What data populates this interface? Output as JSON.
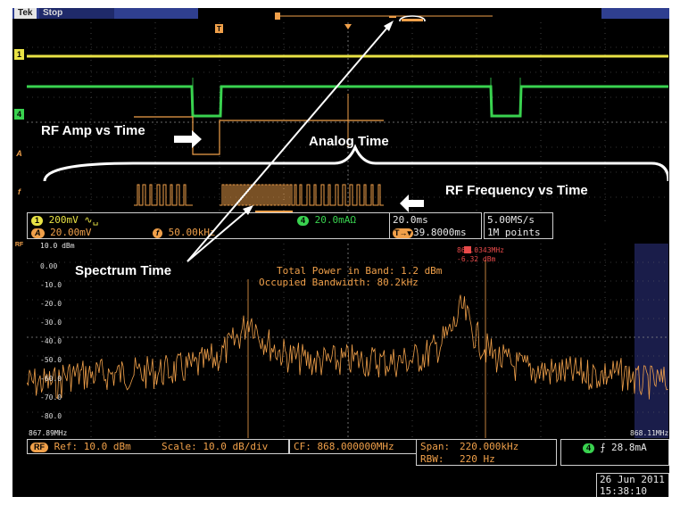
{
  "titlebar": {
    "brand": "Tek",
    "state": "Stop"
  },
  "channels": {
    "ch1": {
      "marker": "1",
      "scale": "200mV",
      "color": "#e8e245"
    },
    "ch4": {
      "marker": "4",
      "scale": "20.0mA",
      "unit_suffix": "Ω",
      "color": "#39d24f"
    },
    "math_a": {
      "marker": "A",
      "scale": "20.00mV",
      "color": "#f0a04a"
    },
    "math_f": {
      "marker": "f",
      "scale": "50.00kHz",
      "color": "#f0a04a"
    }
  },
  "timebase": {
    "scale": "20.0ms",
    "trigger_pos": "39.8000ms",
    "sample_rate": "5.00MS/s",
    "record": "1M points"
  },
  "annotations": {
    "rf_amp": "RF Amp vs Time",
    "analog_time": "Analog Time",
    "rf_freq": "RF Frequency vs Time",
    "spectrum_time": "Spectrum Time"
  },
  "rf": {
    "marker": "RF",
    "y_ticks": [
      "10.0 dBm",
      "0.00",
      "-10.0",
      "-20.0",
      "-30.0",
      "-40.0",
      "-50.0",
      "-60.0",
      "-70.0",
      "-80.0"
    ],
    "start_freq": "867.89MHz",
    "stop_freq": "868.11MHz",
    "marker_badge": "R",
    "marker_freq": "868.0343MHz",
    "marker_level": "-6.32 dBm",
    "measure_line1": "Total Power in Band: 1.2 dBm",
    "measure_line2": "Occupied Bandwidth: 80.2kHz",
    "ref": "Ref: 10.0 dBm",
    "scale": "Scale: 10.0 dB/div",
    "cf": "CF: 868.000000MHz",
    "span_label": "Span:",
    "span": "220.000kHz",
    "rbw_label": "RBW:",
    "rbw": "220 Hz"
  },
  "trigger": {
    "channel": "4",
    "slope": "rising",
    "level": "28.8mA"
  },
  "datetime": {
    "date": "26 Jun 2011",
    "time": "15:38:10"
  }
}
